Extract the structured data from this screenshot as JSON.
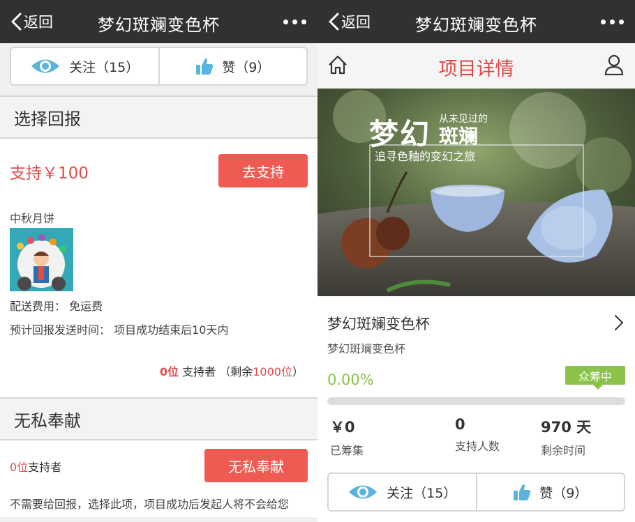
{
  "left": {
    "topbar": {
      "back_label": "返回",
      "title": "梦幻斑斓变色杯"
    },
    "follow": {
      "follow_label": "关注（15）",
      "like_label": "赞（9）"
    },
    "section1": {
      "title": "选择回报"
    },
    "reward": {
      "price_label": "支持￥100",
      "support_button": "去支持",
      "name": "中秋月饼",
      "shipping_label": "配送费用：",
      "shipping_value": "免运费",
      "delivery_label": "预计回报发送时间：",
      "delivery_value": "项目成功结束后10天内",
      "backers_count": "0位",
      "backers_text": " 支持者 （剩余",
      "remaining": "1000位",
      "backers_close": "）"
    },
    "section2": {
      "title": "无私奉献"
    },
    "donate": {
      "backers_count": "0位",
      "backers_text": "支持者",
      "button": "无私奉献",
      "desc": "不需要给回报，选择此项，项目成功后发起人将不会给您"
    }
  },
  "right": {
    "topbar": {
      "back_label": "返回",
      "title": "梦幻斑斓变色杯"
    },
    "subnav": {
      "title": "项目详情"
    },
    "hero": {
      "big": "梦幻",
      "small": "从未见过的",
      "name": "斑斓",
      "tagline": "追寻色釉的变幻之旅"
    },
    "project": {
      "title": "梦幻斑斓变色杯",
      "subtitle": "梦幻斑斓变色杯",
      "percent": "0.00%",
      "progress": 0,
      "status": "众筹中"
    },
    "stats": [
      {
        "value": "￥0",
        "label": "已筹集"
      },
      {
        "value": "0",
        "label": "支持人数"
      },
      {
        "value": "970 天",
        "label": "剩余时间"
      }
    ],
    "follow": {
      "follow_label": "关注（15）",
      "like_label": "赞（9）"
    }
  },
  "colors": {
    "accent_red": "#ef5a52",
    "price_red": "#e34b4b",
    "green": "#8bc34a",
    "topbar": "#313131",
    "eye_blue": "#5bb4dd"
  },
  "icons": [
    "back-chevron-icon",
    "more-dots-icon",
    "eye-icon",
    "thumbs-up-icon",
    "home-icon",
    "user-icon",
    "chevron-right-icon"
  ]
}
